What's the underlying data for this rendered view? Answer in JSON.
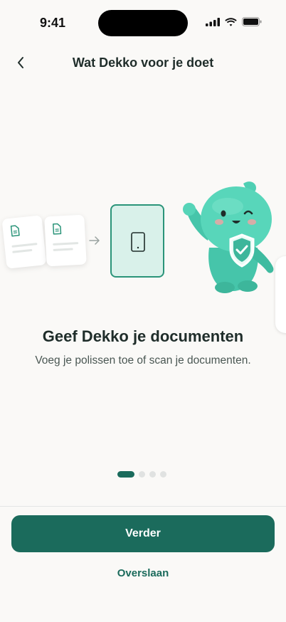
{
  "status_bar": {
    "time": "9:41"
  },
  "header": {
    "title": "Wat Dekko voor je doet",
    "back_icon": "chevron-left-icon"
  },
  "slide": {
    "title": "Geef Dekko je documenten",
    "subtitle": "Voeg je polissen toe of scan je documenten."
  },
  "pager": {
    "total": 4,
    "active_index": 0
  },
  "actions": {
    "primary_label": "Verder",
    "secondary_label": "Overslaan"
  },
  "colors": {
    "brand": "#1b6b5c",
    "accent": "#2a9479",
    "mascot": "#4fcfb3"
  }
}
